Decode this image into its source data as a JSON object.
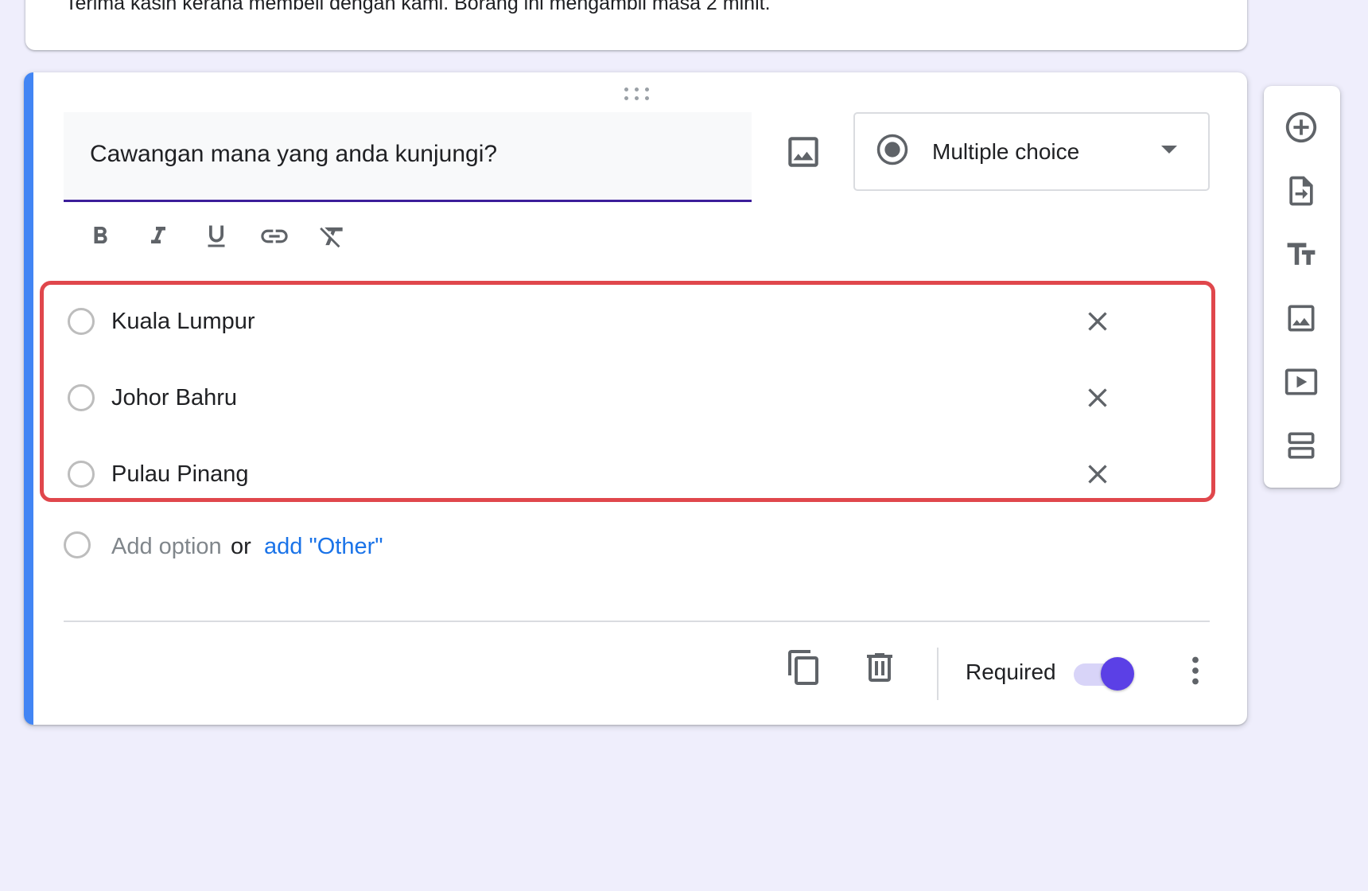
{
  "form": {
    "description": "Terima kasih kerana membeli dengan kami. Borang ini mengambil masa 2 minit."
  },
  "question": {
    "title": "Cawangan mana yang anda kunjungi?",
    "type": "Multiple choice",
    "options": [
      {
        "label": "Kuala Lumpur"
      },
      {
        "label": "Johor Bahru"
      },
      {
        "label": "Pulau Pinang"
      }
    ],
    "add_option": "Add option",
    "or": "or",
    "add_other": "add \"Other\"",
    "required_label": "Required",
    "required": true
  },
  "colors": {
    "accent_bar": "#4285f4",
    "title_underline": "#3c1e9a",
    "highlight_border": "#e0474c",
    "toggle_on": "#5b40e6",
    "link": "#1a73e8",
    "background": "#efeefc"
  },
  "formatting_toolbar": [
    "bold-icon",
    "italic-icon",
    "underline-icon",
    "link-icon",
    "clear-formatting-icon"
  ],
  "side_toolbar": [
    "add-question-icon",
    "import-questions-icon",
    "add-title-icon",
    "add-image-icon",
    "add-video-icon",
    "add-section-icon"
  ],
  "footer_actions": [
    "duplicate-icon",
    "delete-icon",
    "more-options-icon"
  ]
}
